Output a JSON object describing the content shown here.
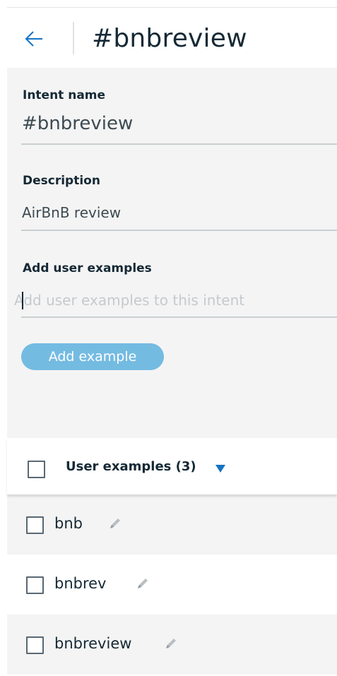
{
  "header": {
    "title": "#bnbreview",
    "back_icon": "arrow-left-icon"
  },
  "form": {
    "intent_name_label": "Intent name",
    "intent_name_value": "#bnbreview",
    "description_label": "Description",
    "description_value": "AirBnB review",
    "user_examples_label": "Add user examples",
    "user_examples_placeholder": "Add user examples to this intent",
    "user_examples_value": "",
    "add_example_button": "Add example"
  },
  "list": {
    "header_label": "User examples (3)",
    "sort_icon": "sort-down-triangle-icon",
    "rows": [
      {
        "text": "bnb",
        "edit_icon": "pencil-icon"
      },
      {
        "text": "bnbrev",
        "edit_icon": "pencil-icon"
      },
      {
        "text": "bnbreview",
        "edit_icon": "pencil-icon"
      }
    ]
  },
  "colors": {
    "accent": "#1473c4",
    "button": "#74bbe2",
    "panel": "#f4f4f4",
    "text": "#152935"
  }
}
